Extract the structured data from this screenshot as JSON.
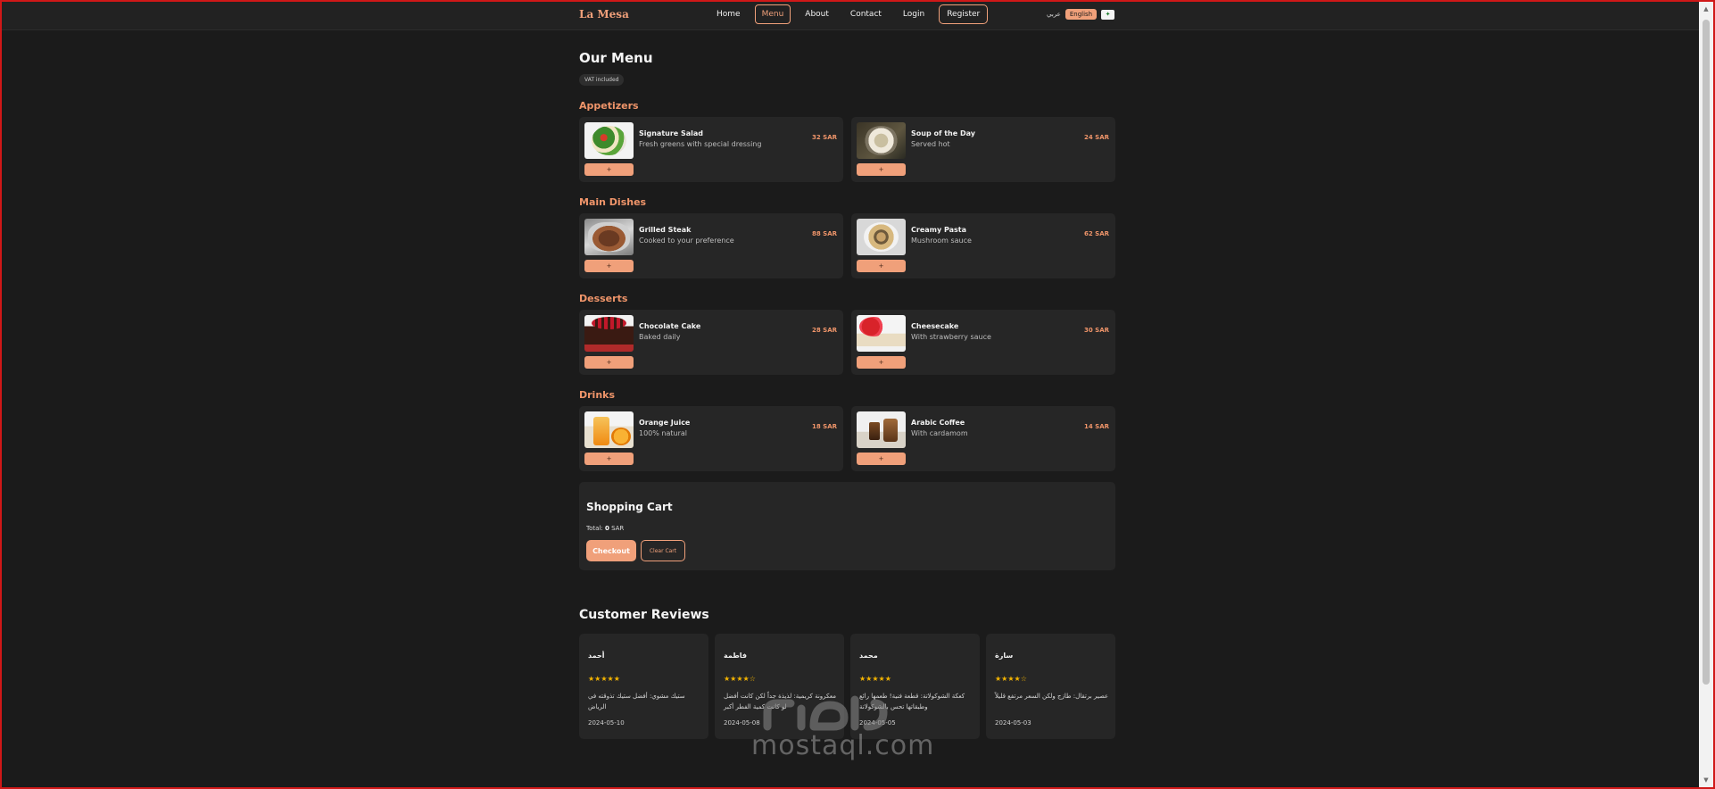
{
  "brand": "La Mesa",
  "nav": {
    "links": [
      {
        "label": "Home",
        "active": false
      },
      {
        "label": "Menu",
        "active": true
      },
      {
        "label": "About",
        "active": false
      },
      {
        "label": "Contact",
        "active": false
      },
      {
        "label": "Login",
        "active": false
      }
    ],
    "register_label": "Register"
  },
  "lang": {
    "arabic_label": "عربي",
    "english_label": "English"
  },
  "menu": {
    "title": "Our Menu",
    "vat_badge": "VAT included",
    "add_label": "+",
    "categories": [
      {
        "title": "Appetizers",
        "items": [
          {
            "name": "Signature Salad",
            "desc": "Fresh greens with special dressing",
            "price": "32 SAR",
            "icon": "salad-image"
          },
          {
            "name": "Soup of the Day",
            "desc": "Served hot",
            "price": "24 SAR",
            "icon": "soup-image"
          }
        ]
      },
      {
        "title": "Main Dishes",
        "items": [
          {
            "name": "Grilled Steak",
            "desc": "Cooked to your preference",
            "price": "88 SAR",
            "icon": "steak-image"
          },
          {
            "name": "Creamy Pasta",
            "desc": "Mushroom sauce",
            "price": "62 SAR",
            "icon": "pasta-image"
          }
        ]
      },
      {
        "title": "Desserts",
        "items": [
          {
            "name": "Chocolate Cake",
            "desc": "Baked daily",
            "price": "28 SAR",
            "icon": "cake-image"
          },
          {
            "name": "Cheesecake",
            "desc": "With strawberry sauce",
            "price": "30 SAR",
            "icon": "cheesecake-image"
          }
        ]
      },
      {
        "title": "Drinks",
        "items": [
          {
            "name": "Orange Juice",
            "desc": "100% natural",
            "price": "18 SAR",
            "icon": "juice-image"
          },
          {
            "name": "Arabic Coffee",
            "desc": "With cardamom",
            "price": "14 SAR",
            "icon": "coffee-image"
          }
        ]
      }
    ]
  },
  "cart": {
    "title": "Shopping Cart",
    "total_label": "Total:",
    "total_value": "0",
    "currency": "SAR",
    "checkout_label": "Checkout",
    "clear_label": "Clear Cart"
  },
  "reviews": {
    "title": "Customer Reviews",
    "items": [
      {
        "name": "أحمد",
        "stars": "★★★★★",
        "text": "ستيك مشوي: أفضل ستيك تذوقته في الرياض",
        "date": "2024-05-10"
      },
      {
        "name": "فاطمة",
        "stars": "★★★★☆",
        "text": "معكرونة كريمية: لذيذة جداً لكن كانت أفضل لو كانت كمية الفطر أكبر",
        "date": "2024-05-08"
      },
      {
        "name": "محمد",
        "stars": "★★★★★",
        "text": "كعكة الشوكولاتة: قطعة فنية! طعمها رائع وطبقاتها تحس بالشوكولاتة",
        "date": "2024-05-05"
      },
      {
        "name": "سارة",
        "stars": "★★★★☆",
        "text": "عصير برتقال: طازج ولكن السعر مرتفع قليلاً",
        "date": "2024-05-03"
      }
    ]
  },
  "watermark": {
    "text": "mostaql.com"
  },
  "colors": {
    "accent": "#f0a07a",
    "background": "#1b1b1b",
    "card": "#262626",
    "star": "#f4b400"
  }
}
